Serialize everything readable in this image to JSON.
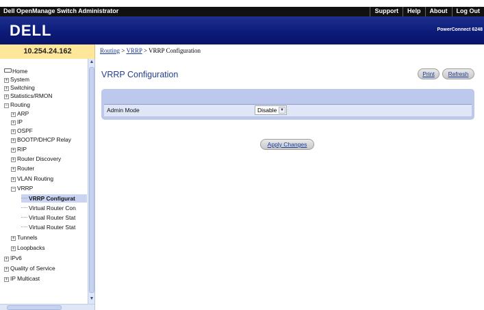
{
  "topbar": {
    "title": "Dell OpenManage Switch Administrator",
    "links": [
      "Support",
      "Help",
      "About",
      "Log Out"
    ]
  },
  "banner": {
    "logo_text": "DELL",
    "product": "PowerConnect 6248"
  },
  "ip_address": "10.254.24.162",
  "breadcrumb": {
    "routing": "Routing",
    "sep1": " > ",
    "vrrp": "VRRP",
    "sep2": " > ",
    "current": "VRRP Configuration"
  },
  "tree": [
    {
      "label": "Home"
    },
    {
      "label": "System"
    },
    {
      "label": "Switching"
    },
    {
      "label": "Statistics/RMON"
    },
    {
      "label": "Routing"
    },
    {
      "label": "ARP"
    },
    {
      "label": "IP"
    },
    {
      "label": "OSPF"
    },
    {
      "label": "BOOTP/DHCP Relay"
    },
    {
      "label": "RIP"
    },
    {
      "label": "Router Discovery"
    },
    {
      "label": "Router"
    },
    {
      "label": "VLAN Routing"
    },
    {
      "label": "VRRP"
    },
    {
      "label": "VRRP Configurat"
    },
    {
      "label": "Virtual Router Con"
    },
    {
      "label": "Virtual Router Stat"
    },
    {
      "label": "Virtual Router Stat"
    },
    {
      "label": "Tunnels"
    },
    {
      "label": "Loopbacks"
    },
    {
      "label": "IPv6"
    },
    {
      "label": "Quality of Service"
    },
    {
      "label": "IP Multicast"
    }
  ],
  "main": {
    "title": "VRRP Configuration",
    "print_label": "Print",
    "refresh_label": "Refresh",
    "admin_mode_label": "Admin Mode",
    "admin_mode_value": "Disable",
    "apply_label": "Apply Changes"
  },
  "colors": {
    "banner": "#0b1a77",
    "ip_row": "#ffe79a",
    "title": "#23408f",
    "panel": "#bcc9ed",
    "link": "#1a3a9c"
  }
}
